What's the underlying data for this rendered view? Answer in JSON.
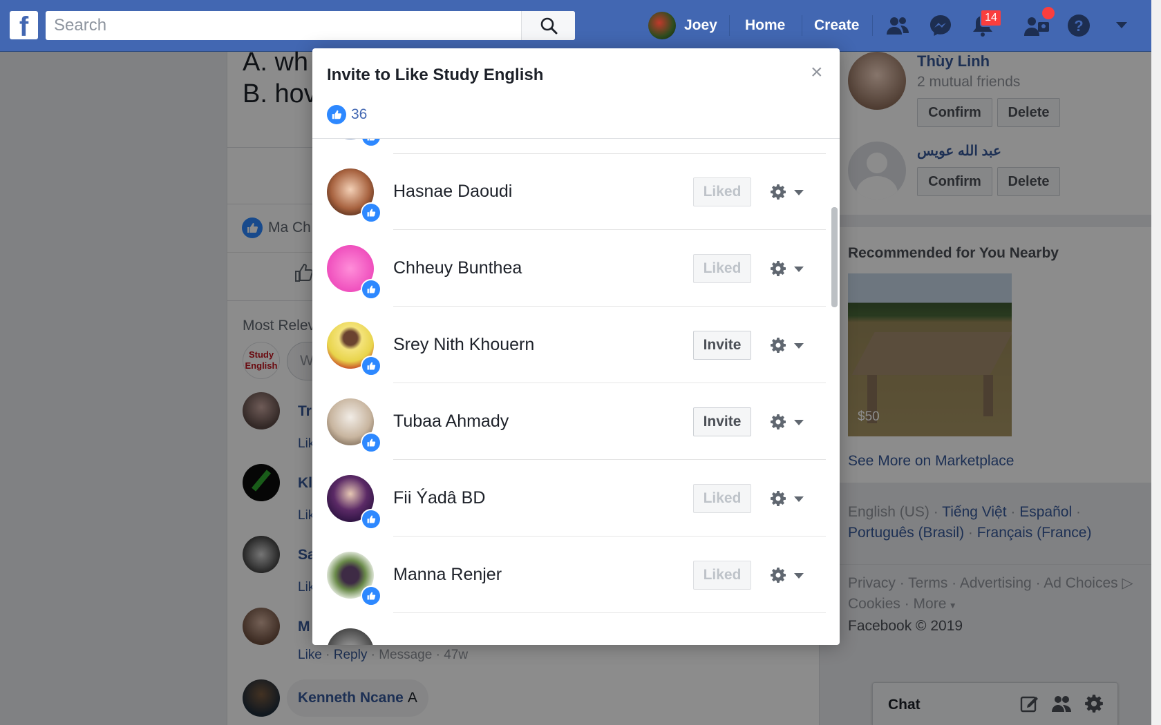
{
  "header": {
    "search_placeholder": "Search",
    "profile_name": "Joey",
    "home_label": "Home",
    "create_label": "Create",
    "notifications_count": "14",
    "icons": [
      "facebook-logo",
      "search-icon",
      "friends-icon",
      "messenger-icon",
      "bell-icon",
      "friend-requests-icon",
      "help-icon",
      "caret-down-icon"
    ]
  },
  "post": {
    "line_a": "A. wh",
    "line_b": "B. hov",
    "liker_fragment": "Ma Ch",
    "most_relevant": "Most Relev",
    "page_avatar_line1": "Study",
    "page_avatar_line2": "English",
    "comment_input_fragment": "W",
    "comments": [
      {
        "name": "Tr",
        "action": "Lik"
      },
      {
        "name": "Kl",
        "action": "Lik"
      },
      {
        "name": "Sa",
        "action": "Lik"
      },
      {
        "name": "M",
        "like": "Like",
        "reply": "Reply",
        "message": "Message",
        "time": "47w"
      },
      {
        "name": "Kenneth Ncane",
        "text": "A"
      }
    ]
  },
  "right": {
    "requests": [
      {
        "name": "Thùy Linh",
        "mutual": "2 mutual friends",
        "confirm": "Confirm",
        "delete": "Delete"
      },
      {
        "name": "عبد الله عويس",
        "confirm": "Confirm",
        "delete": "Delete"
      }
    ],
    "recommended_title": "Recommended for You Nearby",
    "price": "$50",
    "marketplace_link": "See More on Marketplace",
    "languages": [
      "English (US)",
      "Tiếng Việt",
      "Español",
      "Português (Brasil)",
      "Français (France)"
    ],
    "footer_links": [
      "Privacy",
      "Terms",
      "Advertising",
      "Ad Choices",
      "Cookies",
      "More"
    ],
    "copyright": "Facebook © 2019"
  },
  "chat": {
    "label": "Chat"
  },
  "modal": {
    "title": "Invite to Like Study English",
    "close_symbol": "×",
    "like_count": "36",
    "people": [
      {
        "name": "Hasnae Daoudi",
        "action": "Liked"
      },
      {
        "name": "Chheuy Bunthea",
        "action": "Liked"
      },
      {
        "name": "Srey Nith Khouern",
        "action": "Invite"
      },
      {
        "name": "Tubaa Ahmady",
        "action": "Invite"
      },
      {
        "name": "Fii Ýadâ BD",
        "action": "Liked"
      },
      {
        "name": "Manna Renjer",
        "action": "Liked"
      }
    ]
  },
  "colors": {
    "brand": "#4267b2",
    "like_blue": "#2d88ff",
    "notification_red": "#fa3e3e"
  }
}
